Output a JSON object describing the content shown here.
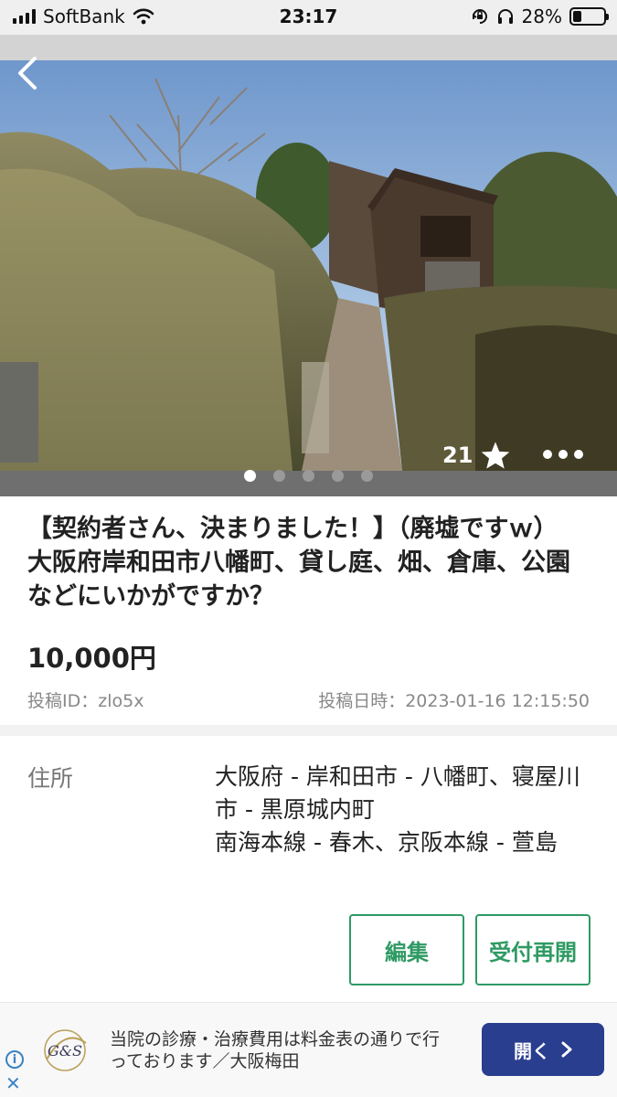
{
  "status_bar": {
    "carrier": "SoftBank",
    "time": "23:17",
    "battery_percent": "28%",
    "battery_level": 0.28
  },
  "gallery": {
    "favorite_count": "21",
    "image_count": 5,
    "active_index": 0
  },
  "listing": {
    "title": "【契約者さん、決まりました！】（廃墟ですｗ）大阪府岸和田市八幡町、貸し庭、畑、倉庫、公園などにいかがですか？",
    "price": "10,000円",
    "post_id": "投稿ID：zlo5x",
    "posted_at": "投稿日時：2023-01-16 12:15:50"
  },
  "address": {
    "label": "住所",
    "lines": [
      "大阪府 - 岸和田市 - 八幡町、寝屋川市 - 黒原城内町",
      "南海本線 - 春木、京阪本線 - 萱島"
    ]
  },
  "actions": {
    "edit": "編集",
    "reopen": "受付再開"
  },
  "ad": {
    "text": "当院の診療・治療費用は料金表の通りで行っております／大阪梅田",
    "open_label": "開く",
    "logo_text": "G&S",
    "info_icon": "i",
    "close_icon": "✕"
  },
  "icons": [
    "signal-icon",
    "wifi-icon",
    "orientation-lock-icon",
    "headphones-icon",
    "battery-icon",
    "back-chevron-icon",
    "star-icon",
    "more-icon",
    "chevron-right-icon"
  ],
  "colors": {
    "accent_green": "#2e9a63",
    "ad_button": "#2a3e8f",
    "info_blue": "#3b82c4"
  }
}
